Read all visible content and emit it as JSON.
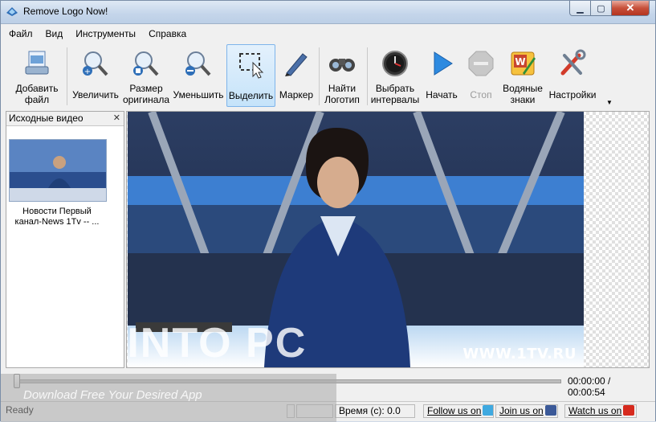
{
  "window": {
    "title": "Remove Logo Now!",
    "minimize_glyph": "▁",
    "maximize_glyph": "▢",
    "close_glyph": "✕"
  },
  "menu": [
    "Файл",
    "Вид",
    "Инструменты",
    "Справка"
  ],
  "toolbar": {
    "add_file": [
      "Добавить",
      "файл"
    ],
    "zoom_in": "Увеличить",
    "original_size": [
      "Размер",
      "оригинала"
    ],
    "zoom_out": "Уменьшить",
    "select": "Выделить",
    "marker": "Маркер",
    "find_logo": [
      "Найти",
      "Логотип"
    ],
    "choose_intervals": [
      "Выбрать",
      "интервалы"
    ],
    "start": "Начать",
    "stop": "Стоп",
    "watermarks": [
      "Водяные",
      "знаки"
    ],
    "settings": "Настройки",
    "overflow_glyph": "▼"
  },
  "sidepanel": {
    "title": "Исходные видео",
    "close_glyph": "✕",
    "items": [
      {
        "caption": [
          "Новости Первый",
          "канал-News 1Tv -- ..."
        ]
      }
    ]
  },
  "video": {
    "watermark": "WWW.1TV.RU"
  },
  "seek": {
    "position_fraction": 0.0,
    "time": "00:00:00 / 00:00:54"
  },
  "status": {
    "state": "Ready",
    "time_label": "Время (с): 0.0",
    "follow": "Follow us on",
    "join": "Join us on",
    "watch": "Watch us on"
  },
  "overlay": {
    "big": "GET INTO PC",
    "small": "Download Free Your Desired App"
  },
  "colors": {
    "accent": "#7eb4ea",
    "close": "#c7503a",
    "twitter": "#3fa9e0",
    "facebook": "#3b5998",
    "youtube": "#d62a1e"
  }
}
